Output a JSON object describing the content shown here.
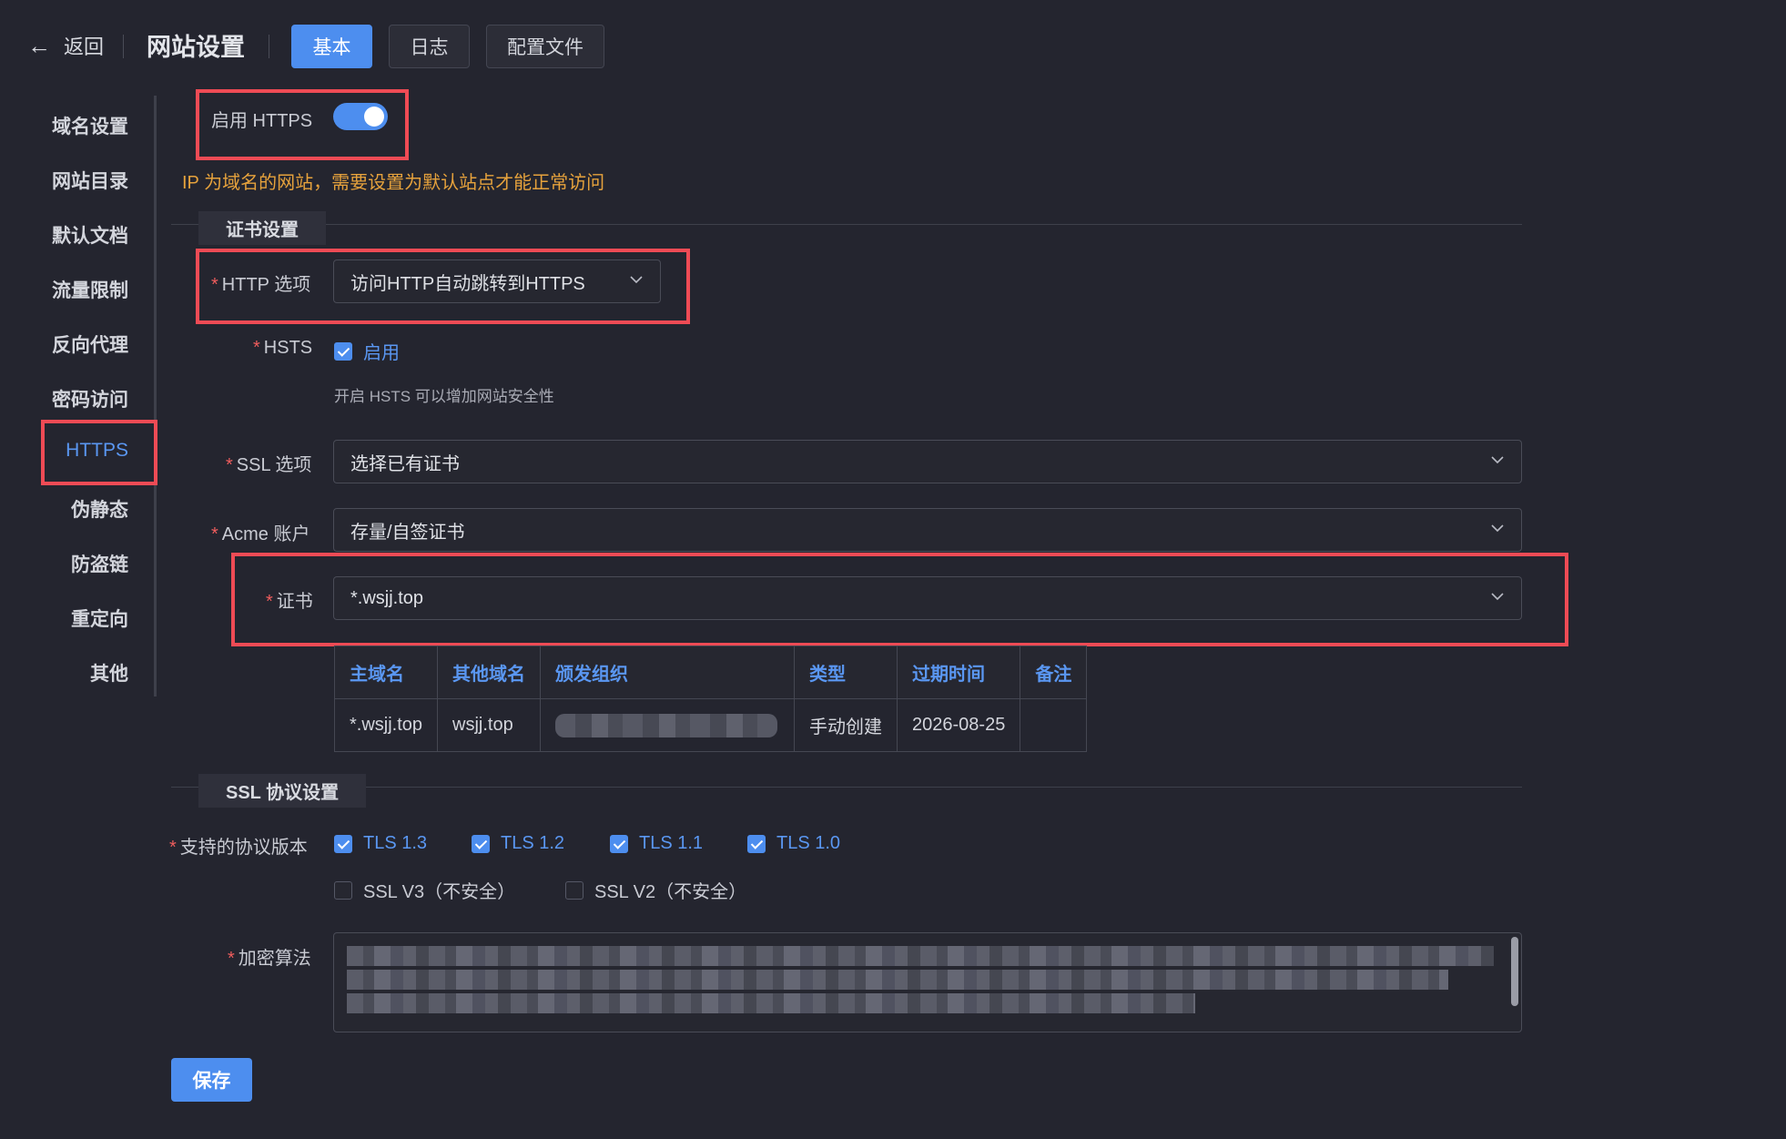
{
  "header": {
    "back_label": "返回",
    "title": "网站设置",
    "tabs": [
      {
        "label": "基本",
        "active": true
      },
      {
        "label": "日志",
        "active": false
      },
      {
        "label": "配置文件",
        "active": false
      }
    ]
  },
  "sidebar": {
    "items": [
      {
        "label": "域名设置"
      },
      {
        "label": "网站目录"
      },
      {
        "label": "默认文档"
      },
      {
        "label": "流量限制"
      },
      {
        "label": "反向代理"
      },
      {
        "label": "密码访问"
      },
      {
        "label": "HTTPS",
        "active": true
      },
      {
        "label": "伪静态"
      },
      {
        "label": "防盗链"
      },
      {
        "label": "重定向"
      },
      {
        "label": "其他"
      }
    ]
  },
  "https": {
    "enable_label": "启用 HTTPS",
    "enabled": true,
    "warning": "IP 为域名的网站，需要设置为默认站点才能正常访问"
  },
  "cert_section": {
    "title": "证书设置",
    "http_option": {
      "label": "HTTP 选项",
      "value": "访问HTTP自动跳转到HTTPS"
    },
    "hsts": {
      "label": "HSTS",
      "checkbox_label": "启用",
      "checked": true,
      "hint": "开启 HSTS 可以增加网站安全性"
    },
    "ssl_option": {
      "label": "SSL 选项",
      "value": "选择已有证书"
    },
    "acme_account": {
      "label": "Acme 账户",
      "value": "存量/自签证书"
    },
    "certificate": {
      "label": "证书",
      "value": "*.wsjj.top"
    },
    "table": {
      "headers": [
        "主域名",
        "其他域名",
        "颁发组织",
        "类型",
        "过期时间",
        "备注"
      ],
      "row": {
        "primary": "*.wsjj.top",
        "other": "wsjj.top",
        "issuer": "",
        "type": "手动创建",
        "expires": "2026-08-25",
        "note": ""
      }
    }
  },
  "ssl_section": {
    "title": "SSL 协议设置",
    "protocol_label": "支持的协议版本",
    "protocols": [
      {
        "label": "TLS 1.3",
        "checked": true
      },
      {
        "label": "TLS 1.2",
        "checked": true
      },
      {
        "label": "TLS 1.1",
        "checked": true
      },
      {
        "label": "TLS 1.0",
        "checked": true
      },
      {
        "label": "SSL V3（不安全）",
        "checked": false
      },
      {
        "label": "SSL V2（不安全）",
        "checked": false
      }
    ],
    "cipher_label": "加密算法"
  },
  "save_label": "保存",
  "colors": {
    "accent": "#4d8eef",
    "warning": "#e6a23c",
    "highlight": "#ef4b55",
    "background": "#24252f"
  }
}
